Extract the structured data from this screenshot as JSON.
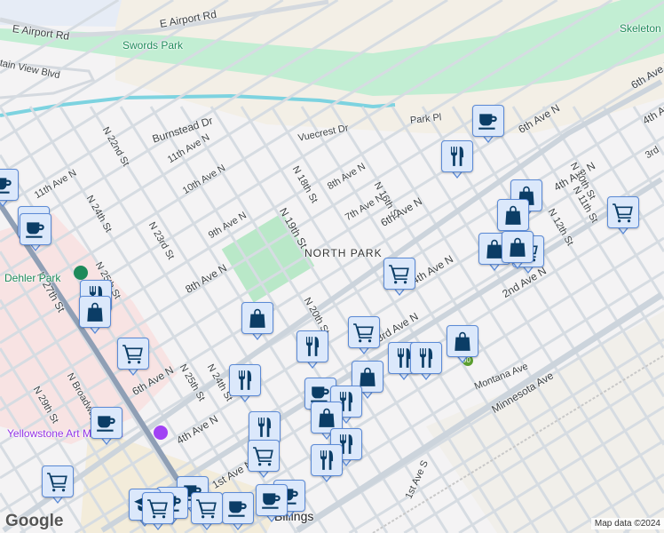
{
  "map": {
    "roads": {
      "e_airport_rd": "E Airport Rd",
      "mountain_view_blvd": "tain View Blvd",
      "burnstead_dr": "Burnstead Dr",
      "vuecrest_dr": "Vuecrest Dr",
      "park_pl": "Park Pl",
      "n22nd": "N 22nd St",
      "n24th": "N 24th St",
      "n23rd": "N 23rd St",
      "n25th_a": "N 25th St",
      "n19th": "N 19th St",
      "n18th": "N 18th St",
      "n16th": "N 16th St",
      "n20th": "N 20th St",
      "n12th": "N 12th St",
      "n11th": "N 11th St",
      "n10th": "N 10th St",
      "n27th": "N 27th St",
      "n29th": "N 29th St",
      "nbroadway": "N Broadway",
      "n25th_b": "N 25th St",
      "n24th_b": "N 24th St",
      "ave11": "11th Ave N",
      "ave10": "10th Ave N",
      "ave9": "9th Ave N",
      "ave8_a": "8th Ave N",
      "ave8_b": "8th Ave N",
      "ave7": "7th Ave N",
      "ave6_a": "6th Ave N",
      "ave6_b": "6th Ave N",
      "ave6_c": "6th Ave N",
      "ave6_d": "6th Ave N",
      "ave4_a": "4th Ave N",
      "ave4_b": "4th Ave N",
      "ave4_c": "4th Ave N",
      "ave4_d": "4th Ave N",
      "ave3": "3rd Ave N",
      "ave2": "2nd Ave N",
      "ave1": "1st Ave N",
      "ave11_left": "11th Ave N",
      "montana": "Montana Ave",
      "minnesota": "Minnesota Ave",
      "first_ave_s": "1st Ave S",
      "third": "3rd"
    },
    "places": {
      "swords_park": "Swords Park",
      "skeleton": "Skeleton",
      "dehler_park": "Dehler Park",
      "north_park": "NORTH PARK",
      "museum": "Yellowstone Art Museum",
      "billings": "Billings"
    },
    "highway_shield": "90",
    "markers": [
      "cafe",
      "restaurant",
      "cafe",
      "shopping",
      "shopping",
      "shopping",
      "cart",
      "cart",
      "cafe",
      "cafe",
      "restaurant",
      "shopping",
      "shopping",
      "cart",
      "cart",
      "restaurant",
      "shopping",
      "restaurant",
      "restaurant",
      "shopping",
      "cart",
      "restaurant",
      "cafe",
      "restaurant",
      "shopping",
      "restaurant",
      "restaurant",
      "restaurant",
      "cart",
      "cafe",
      "cart",
      "cafe",
      "cafe",
      "school",
      "cart",
      "cafe",
      "cart",
      "cafe",
      "cafe",
      "shopping"
    ],
    "colors": {
      "marker_fill": "#dbe8fb",
      "marker_border": "#5b8ad6",
      "icon": "#0b3d66",
      "park": "#c2eed3",
      "water": "#e6ecf6",
      "river": "#7dd3e0",
      "tan": "#f3efe6"
    }
  },
  "footer": {
    "logo": "Google",
    "attribution": "Map data ©2024"
  }
}
